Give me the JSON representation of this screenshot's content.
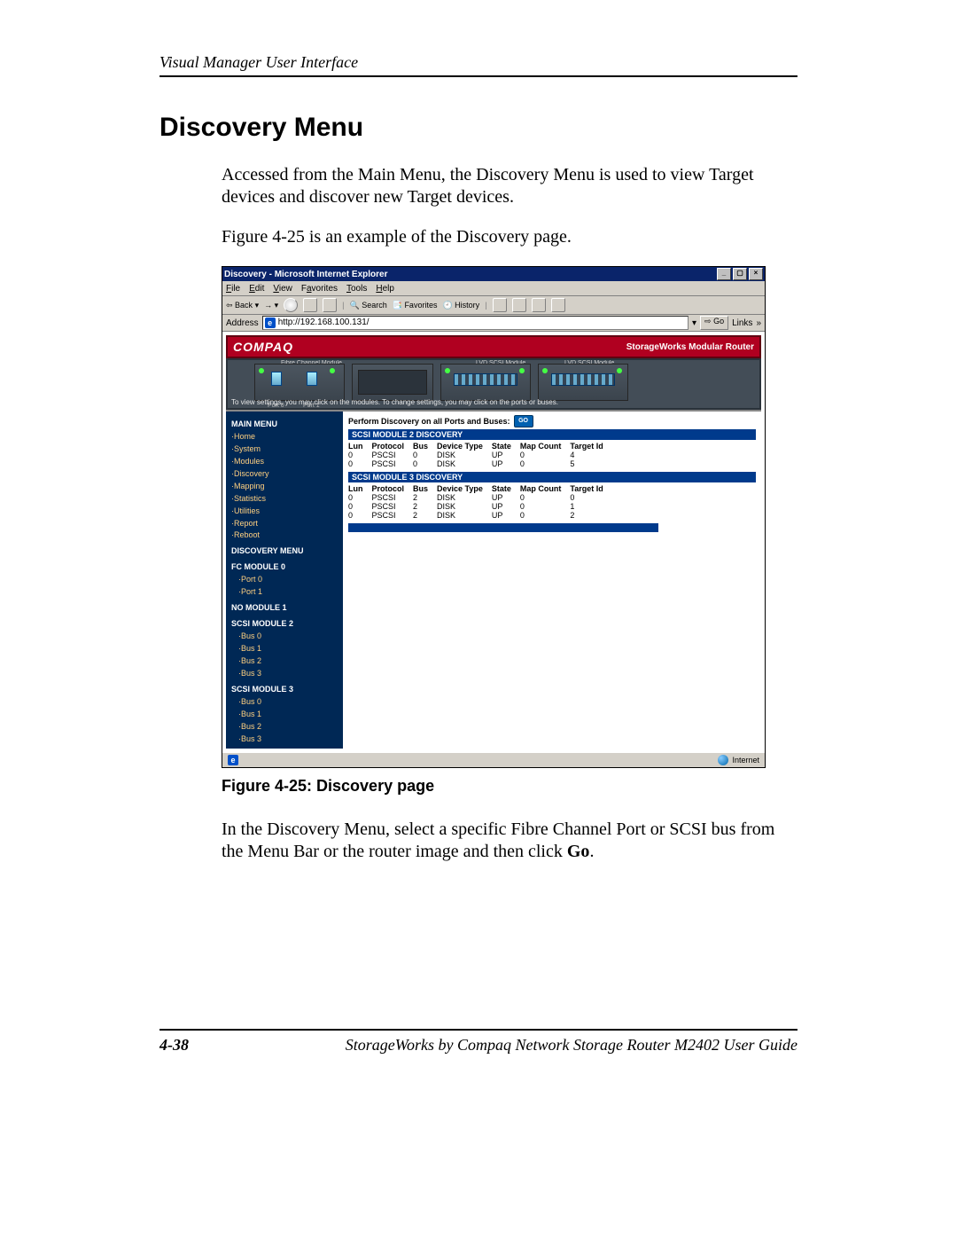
{
  "page": {
    "running_head": "Visual Manager User Interface",
    "title": "Discovery Menu",
    "para1": "Accessed from the Main Menu, the Discovery Menu is used to view Target devices and discover new Target devices.",
    "para2": "Figure 4-25 is an example of the Discovery page.",
    "figcaption": "Figure 4-25:  Discovery page",
    "para3a": "In the Discovery Menu, select a specific Fibre Channel Port or SCSI bus from the Menu Bar or the router image and then click ",
    "para3b": "Go",
    "para3c": ".",
    "footer_page": "4-38",
    "footer_text": "StorageWorks by Compaq Network Storage Router M2402 User Guide"
  },
  "ie": {
    "title": "Discovery - Microsoft Internet Explorer",
    "menu": {
      "file": "File",
      "edit": "Edit",
      "view": "View",
      "favorites": "Favorites",
      "tools": "Tools",
      "help": "Help"
    },
    "toolbar": {
      "back": "Back",
      "search": "Search",
      "favorites": "Favorites",
      "history": "History"
    },
    "address_label": "Address",
    "address_value": "http://192.168.100.131/",
    "go": "Go",
    "links": "Links",
    "status_right": "Internet"
  },
  "compaq": {
    "logo": "COMPAQ",
    "subtitle": "StorageWorks Modular Router",
    "mod_fc": "Fibre Channel Module",
    "mod_scsi_l": "LVD SCSI Module",
    "mod_scsi_r": "LVD SCSI Module",
    "port0": "Port 0",
    "port1": "Port 1",
    "instruction": "To view settings, you may click on the modules. To change settings, you may click on the ports or buses."
  },
  "sidebar": {
    "main_menu": "MAIN MENU",
    "items": [
      "Home",
      "System",
      "Modules",
      "Discovery",
      "Mapping",
      "Statistics",
      "Utilities",
      "Report",
      "Reboot"
    ],
    "disc_menu": "DISCOVERY MENU",
    "fc0": "FC MODULE 0",
    "fc0_items": [
      "Port 0",
      "Port 1"
    ],
    "nomod": "NO MODULE 1",
    "scsi2": "SCSI MODULE 2",
    "scsi2_items": [
      "Bus 0",
      "Bus 1",
      "Bus 2",
      "Bus 3"
    ],
    "scsi3": "SCSI MODULE 3",
    "scsi3_items": [
      "Bus 0",
      "Bus 1",
      "Bus 2",
      "Bus 3"
    ]
  },
  "main": {
    "perform": "Perform Discovery on all Ports and Buses:",
    "go": "GO",
    "hdr2": "SCSI MODULE 2 DISCOVERY",
    "hdr3": "SCSI MODULE 3 DISCOVERY",
    "cols": {
      "lun": "Lun",
      "protocol": "Protocol",
      "bus": "Bus",
      "devtype": "Device Type",
      "state": "State",
      "mapcount": "Map Count",
      "targetid": "Target Id"
    },
    "mod2": [
      {
        "lun": "0",
        "protocol": "PSCSI",
        "bus": "0",
        "devtype": "DISK",
        "state": "UP",
        "mapcount": "0",
        "targetid": "4"
      },
      {
        "lun": "0",
        "protocol": "PSCSI",
        "bus": "0",
        "devtype": "DISK",
        "state": "UP",
        "mapcount": "0",
        "targetid": "5"
      }
    ],
    "mod3": [
      {
        "lun": "0",
        "protocol": "PSCSI",
        "bus": "2",
        "devtype": "DISK",
        "state": "UP",
        "mapcount": "0",
        "targetid": "0"
      },
      {
        "lun": "0",
        "protocol": "PSCSI",
        "bus": "2",
        "devtype": "DISK",
        "state": "UP",
        "mapcount": "0",
        "targetid": "1"
      },
      {
        "lun": "0",
        "protocol": "PSCSI",
        "bus": "2",
        "devtype": "DISK",
        "state": "UP",
        "mapcount": "0",
        "targetid": "2"
      }
    ]
  }
}
